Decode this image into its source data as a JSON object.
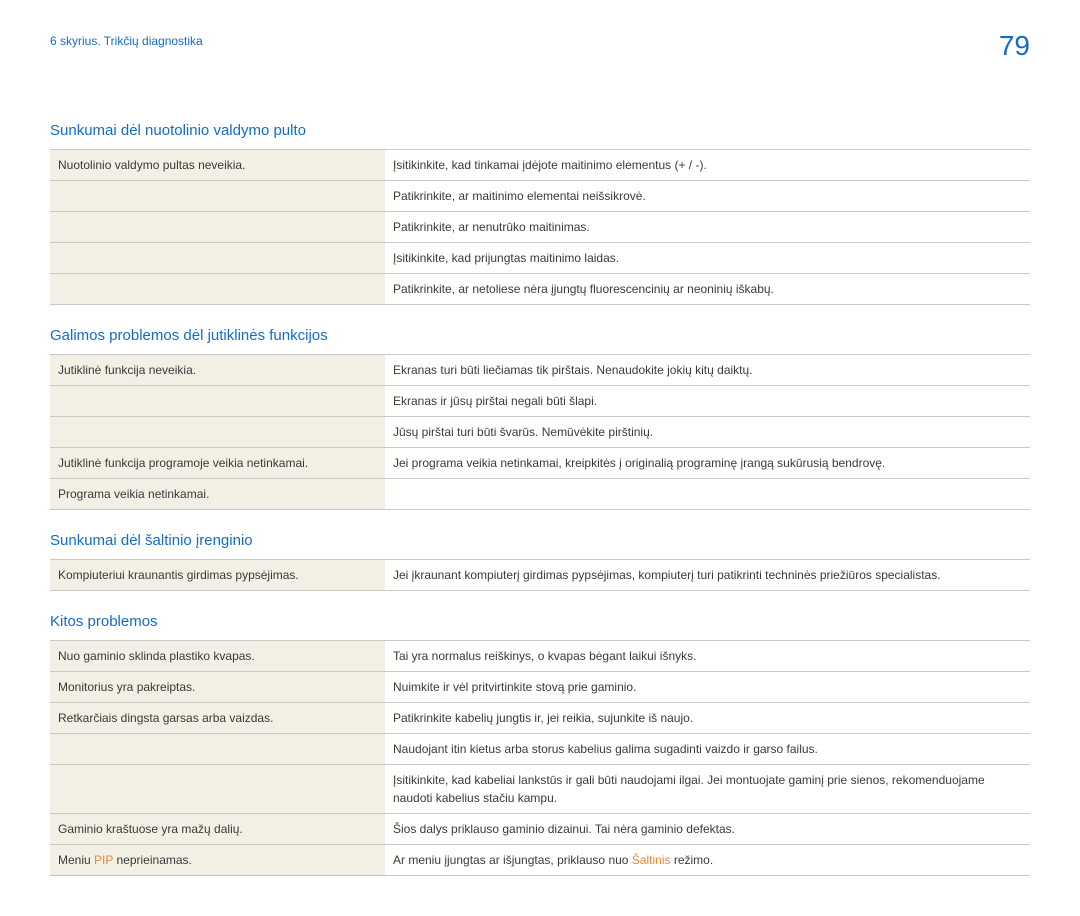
{
  "header": {
    "breadcrumb": "6 skyrius. Trikčių diagnostika",
    "page_number": "79"
  },
  "sections": [
    {
      "title": "Sunkumai dėl nuotolinio valdymo pulto",
      "rows": [
        {
          "left": "Nuotolinio valdymo pultas neveikia.",
          "right": "Įsitikinkite, kad tinkamai įdėjote maitinimo elementus (+ / -)."
        },
        {
          "left": "",
          "right": "Patikrinkite, ar maitinimo elementai neišsikrovė."
        },
        {
          "left": "",
          "right": "Patikrinkite, ar nenutrūko maitinimas."
        },
        {
          "left": "",
          "right": "Įsitikinkite, kad prijungtas maitinimo laidas."
        },
        {
          "left": "",
          "right": "Patikrinkite, ar netoliese nėra įjungtų fluorescencinių ar neoninių iškabų."
        }
      ]
    },
    {
      "title": "Galimos problemos dėl jutiklinės funkcijos",
      "rows": [
        {
          "left": "Jutiklinė funkcija neveikia.",
          "right": "Ekranas turi būti liečiamas tik pirštais. Nenaudokite jokių kitų daiktų."
        },
        {
          "left": "",
          "right": "Ekranas ir jūsų pirštai negali būti šlapi."
        },
        {
          "left": "",
          "right": "Jūsų pirštai turi būti švarūs. Nemūvėkite pirštinių."
        },
        {
          "left": "Jutiklinė funkcija programoje veikia netinkamai.",
          "right": "Jei programa veikia netinkamai, kreipkitės į originalią programinę įrangą sukūrusią bendrovę."
        },
        {
          "left": "Programa veikia netinkamai.",
          "right": ""
        }
      ]
    },
    {
      "title": "Sunkumai dėl šaltinio įrenginio",
      "rows": [
        {
          "left": "Kompiuteriui kraunantis girdimas pypsėjimas.",
          "right": "Jei įkraunant kompiuterį girdimas pypsėjimas, kompiuterį turi patikrinti techninės priežiūros specialistas."
        }
      ]
    },
    {
      "title": "Kitos problemos",
      "rows": [
        {
          "left": "Nuo gaminio sklinda plastiko kvapas.",
          "right": "Tai yra normalus reiškinys, o kvapas bėgant laikui išnyks."
        },
        {
          "left": "Monitorius yra pakreiptas.",
          "right": "Nuimkite ir vėl pritvirtinkite stovą prie gaminio."
        },
        {
          "left": "Retkarčiais dingsta garsas arba vaizdas.",
          "right": "Patikrinkite kabelių jungtis ir, jei reikia, sujunkite iš naujo."
        },
        {
          "left": "",
          "right": "Naudojant itin kietus arba storus kabelius galima sugadinti vaizdo ir garso failus."
        },
        {
          "left": "",
          "right": "Įsitikinkite, kad kabeliai lankstūs ir gali būti naudojami ilgai. Jei montuojate gaminį prie sienos, rekomenduojame naudoti kabelius stačiu kampu."
        },
        {
          "left": "Gaminio kraštuose yra mažų dalių.",
          "right": "Šios dalys priklauso gaminio dizainui. Tai nėra gaminio defektas."
        },
        {
          "left_prefix": "Meniu ",
          "left_highlight": "PIP",
          "left_suffix": " neprieinamas.",
          "right_prefix": "Ar meniu įjungtas ar išjungtas, priklauso nuo ",
          "right_highlight": "Šaltinis",
          "right_suffix": " režimo."
        }
      ]
    }
  ]
}
